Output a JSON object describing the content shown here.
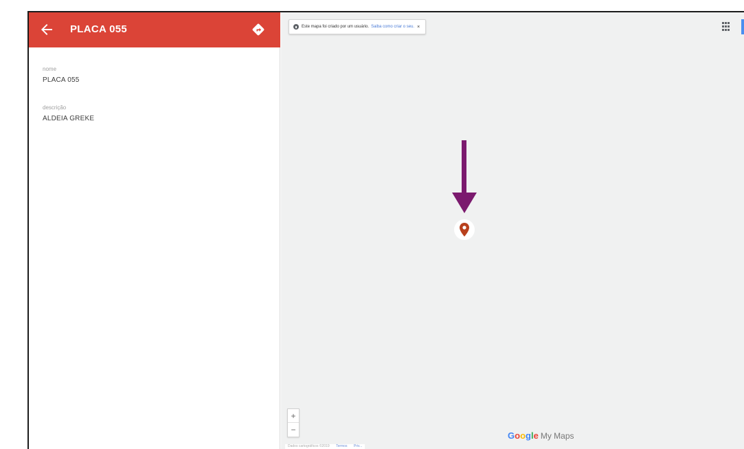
{
  "sidebar": {
    "title": "PLACA 055",
    "back_icon": "arrow-left-icon",
    "directions_icon": "directions-icon",
    "header_color": "#db4437",
    "fields": [
      {
        "label": "nome",
        "value": "PLACA 055"
      },
      {
        "label": "descrição",
        "value": "ALDEIA GREKE"
      }
    ]
  },
  "map": {
    "notice": {
      "text": "Este mapa foi criado por um usuário.",
      "link": "Saiba como criar o seu.",
      "close": "×"
    },
    "grid_icon": "apps-grid-icon",
    "marker_icon": "map-pin-icon",
    "marker_color": "#b8401d",
    "arrow_color": "#7b1a6e",
    "zoom_in": "+",
    "zoom_out": "−",
    "attribution": {
      "text": "Dados cartográficos ©2019",
      "terms": "Termos",
      "privacy": "Priv..."
    },
    "branding": {
      "google": "Google",
      "product": "My Maps"
    }
  }
}
